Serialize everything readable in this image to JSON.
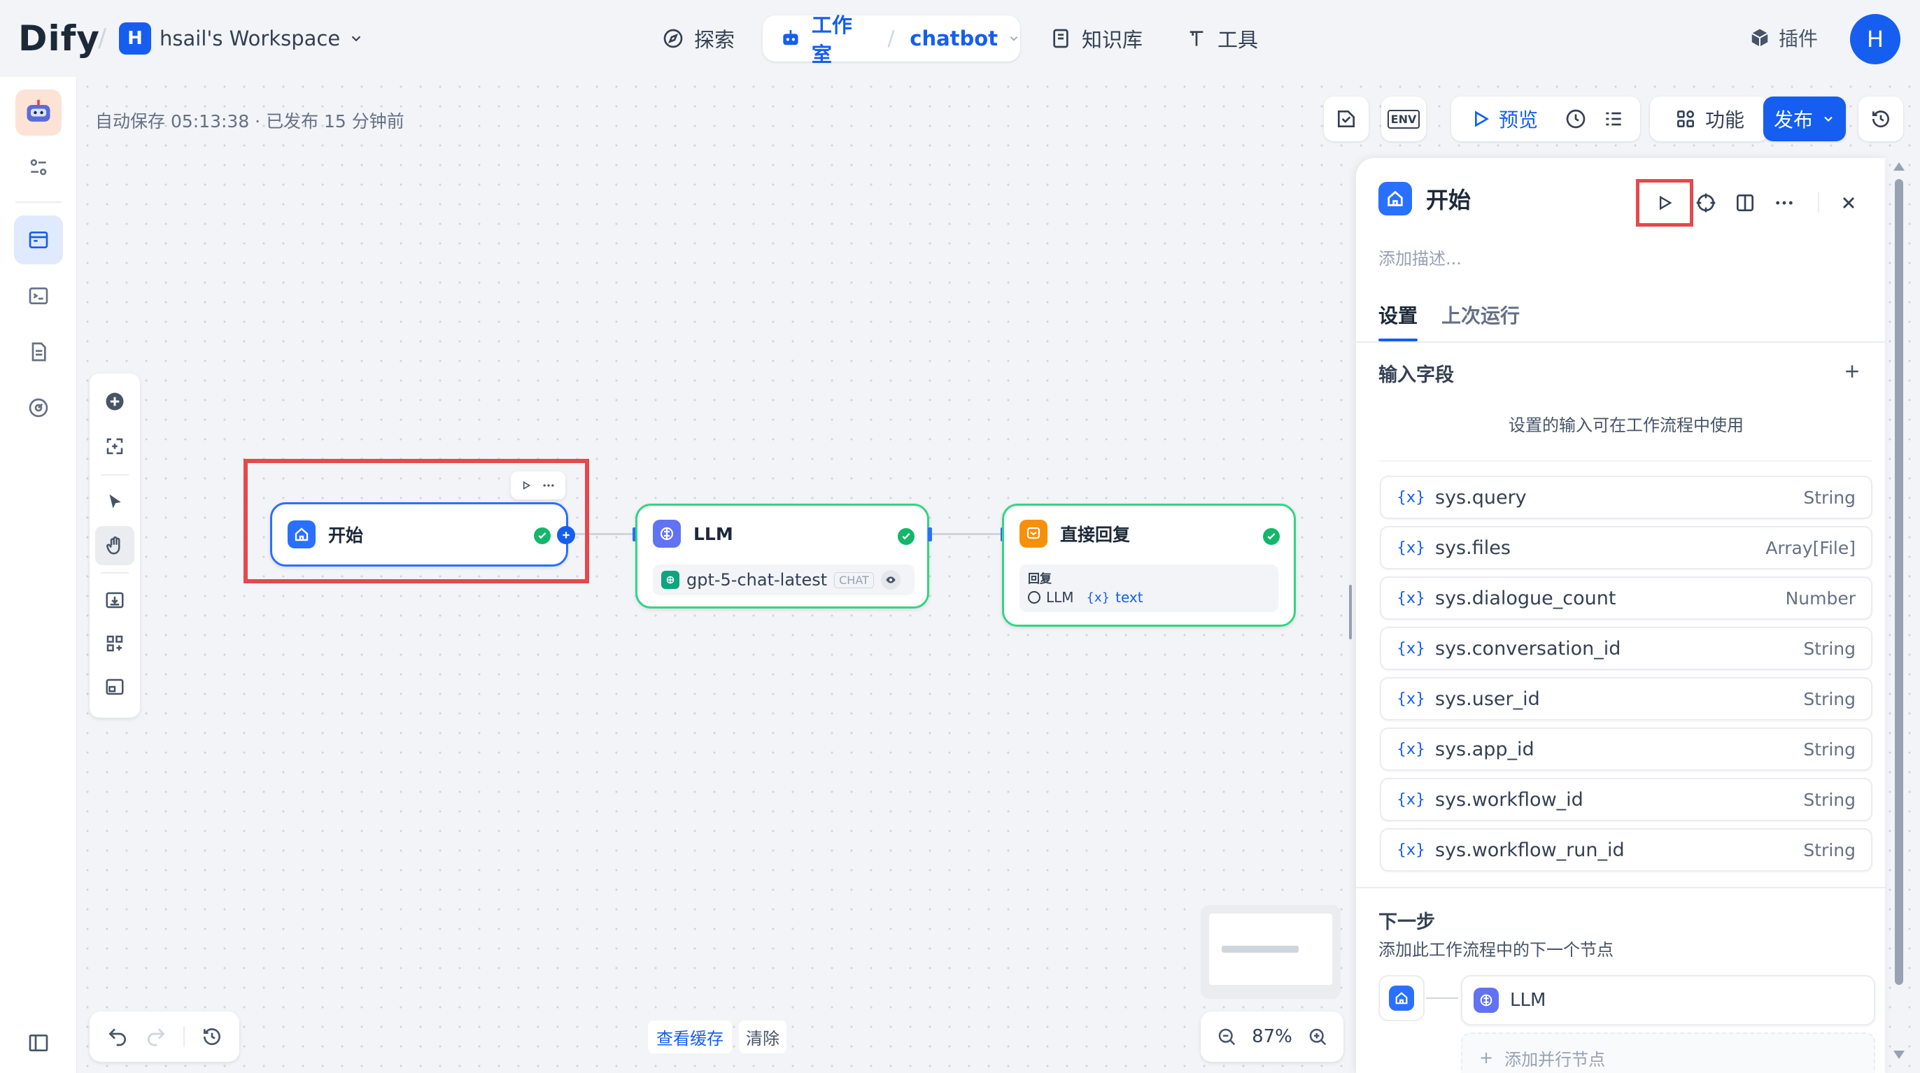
{
  "brand": {
    "logo": "Dify"
  },
  "workspace": {
    "badge": "H",
    "name": "hsail's Workspace"
  },
  "nav": {
    "explore": "探索",
    "studio": "工作室",
    "app_name": "chatbot",
    "knowledge": "知识库",
    "tools": "工具",
    "plugins": "插件",
    "avatar": "H"
  },
  "header": {
    "status": "自动保存 05:13:38 · 已发布 15 分钟前",
    "env": "ENV",
    "preview": "预览",
    "features": "功能",
    "publish": "发布"
  },
  "nodes": {
    "start": {
      "title": "开始"
    },
    "llm": {
      "title": "LLM",
      "model": "gpt-5-chat-latest",
      "mode": "CHAT"
    },
    "answer": {
      "title": "直接回复",
      "label": "回复",
      "ref_node": "LLM",
      "ref_var": "text"
    }
  },
  "panel": {
    "title": "开始",
    "desc_placeholder": "添加描述...",
    "tabs": [
      "设置",
      "上次运行"
    ],
    "input_title": "输入字段",
    "input_hint": "设置的输入可在工作流程中使用",
    "fields": [
      {
        "name": "sys.query",
        "type": "String"
      },
      {
        "name": "sys.files",
        "type": "Array[File]"
      },
      {
        "name": "sys.dialogue_count",
        "type": "Number"
      },
      {
        "name": "sys.conversation_id",
        "type": "String"
      },
      {
        "name": "sys.user_id",
        "type": "String"
      },
      {
        "name": "sys.app_id",
        "type": "String"
      },
      {
        "name": "sys.workflow_id",
        "type": "String"
      },
      {
        "name": "sys.workflow_run_id",
        "type": "String"
      }
    ],
    "next_title": "下一步",
    "next_hint": "添加此工作流程中的下一个节点",
    "next_node": "LLM",
    "add_parallel": "添加并行节点"
  },
  "footer": {
    "view_cache": "查看缓存",
    "clear": "清除",
    "zoom": "87%"
  },
  "colors": {
    "accent": "#155eef",
    "success": "#12b76a",
    "highlight": "#e5484d",
    "answer": "#f79009",
    "llm": "#6172f3"
  }
}
